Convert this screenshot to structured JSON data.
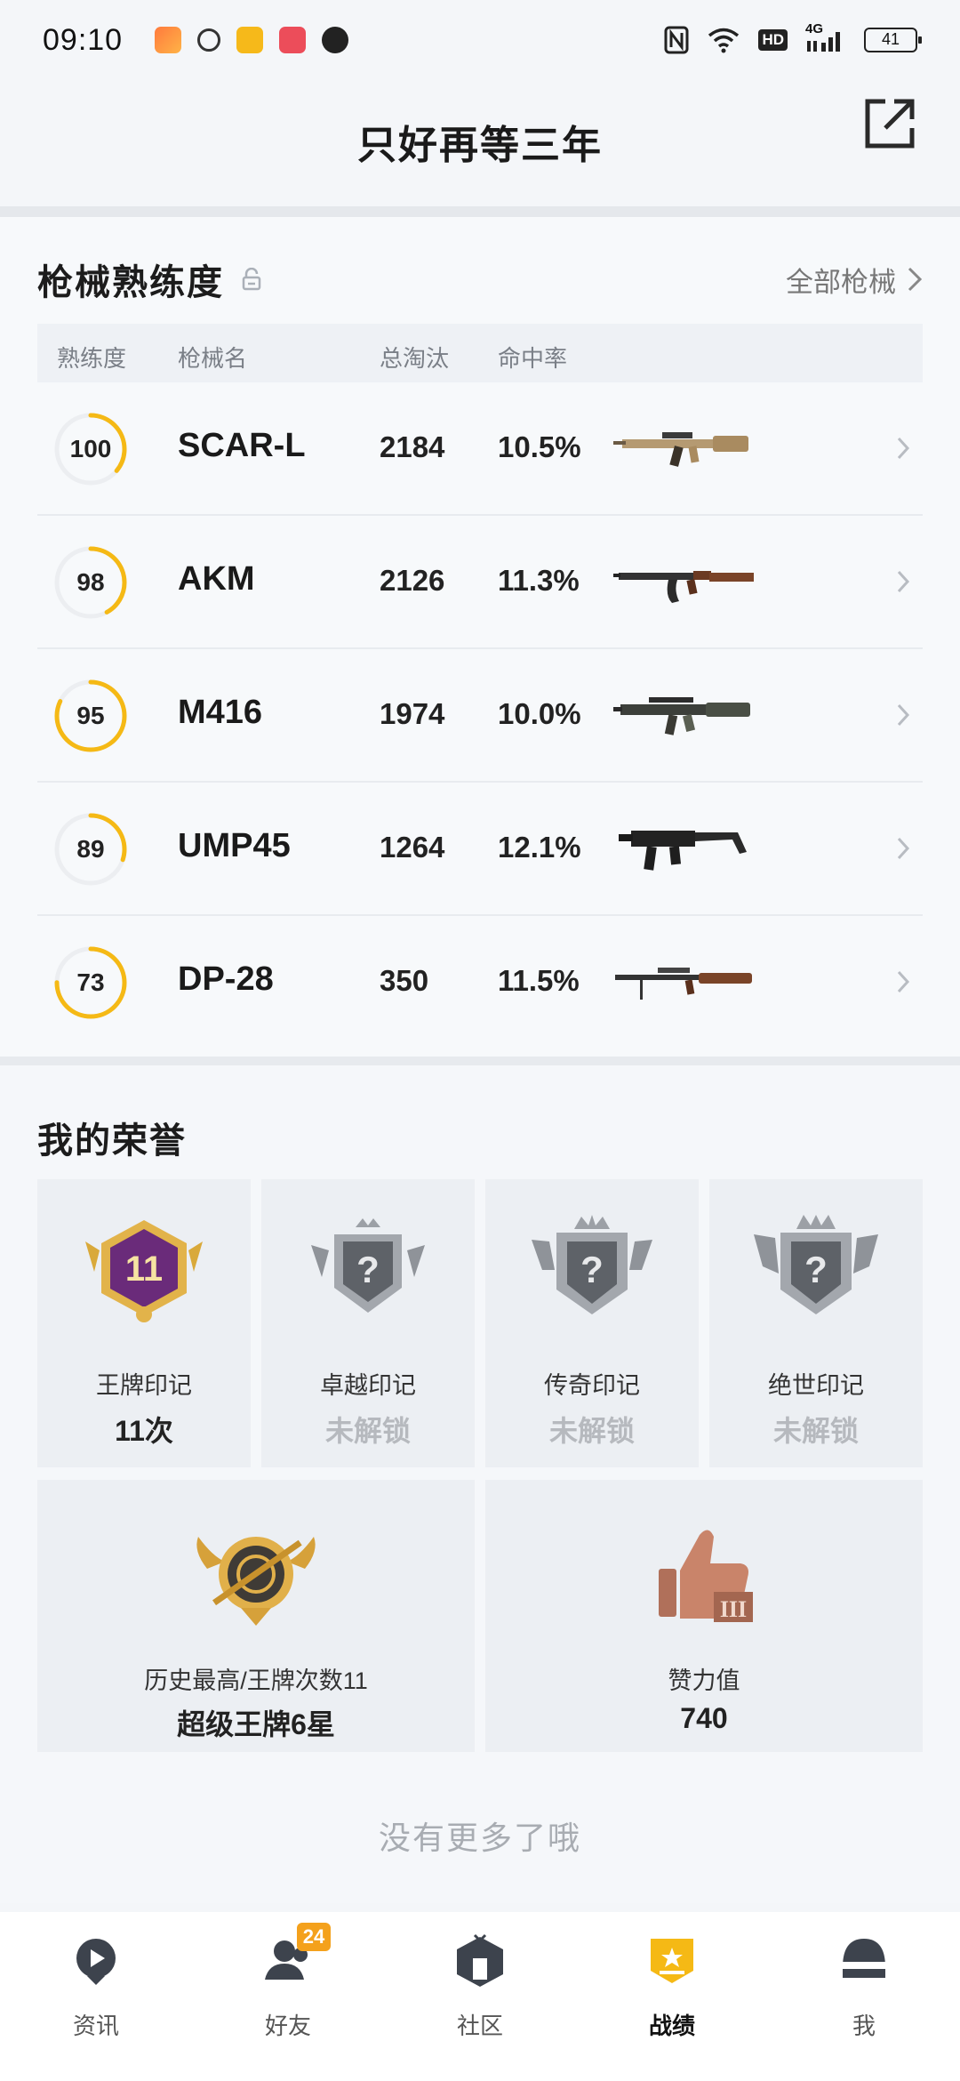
{
  "status_bar": {
    "time": "09:10",
    "battery": "41",
    "network": "4G",
    "hd": "HD"
  },
  "header": {
    "title": "只好再等三年"
  },
  "weapons": {
    "title": "枪械熟练度",
    "all_link": "全部枪械",
    "columns": [
      "熟练度",
      "枪械名",
      "总淘汰",
      "命中率"
    ],
    "rows": [
      {
        "proficiency": "100",
        "name": "SCAR-L",
        "kills": "2184",
        "rate": "10.5%"
      },
      {
        "proficiency": "98",
        "name": "AKM",
        "kills": "2126",
        "rate": "11.3%"
      },
      {
        "proficiency": "95",
        "name": "M416",
        "kills": "1974",
        "rate": "10.0%"
      },
      {
        "proficiency": "89",
        "name": "UMP45",
        "kills": "1264",
        "rate": "12.1%"
      },
      {
        "proficiency": "73",
        "name": "DP-28",
        "kills": "350",
        "rate": "11.5%"
      }
    ],
    "ring_fill": [
      0.36,
      0.42,
      0.82,
      0.3,
      0.75
    ]
  },
  "honor": {
    "title": "我的荣誉",
    "badges": [
      {
        "name": "王牌印记",
        "value": "11次",
        "level": "11"
      },
      {
        "name": "卓越印记",
        "value": "未解锁"
      },
      {
        "name": "传奇印记",
        "value": "未解锁"
      },
      {
        "name": "绝世印记",
        "value": "未解锁"
      }
    ],
    "highest": {
      "label": "历史最高/王牌次数11",
      "value": "超级王牌6星"
    },
    "likes": {
      "label": "赞力值",
      "value": "740"
    }
  },
  "footer_text": "没有更多了哦",
  "nav": {
    "items": [
      {
        "label": "资讯"
      },
      {
        "label": "好友",
        "badge": "24"
      },
      {
        "label": "社区"
      },
      {
        "label": "战绩"
      },
      {
        "label": "我"
      }
    ]
  },
  "colors": {
    "accent": "#f5b915",
    "nav_badge": "#f4a11c"
  }
}
